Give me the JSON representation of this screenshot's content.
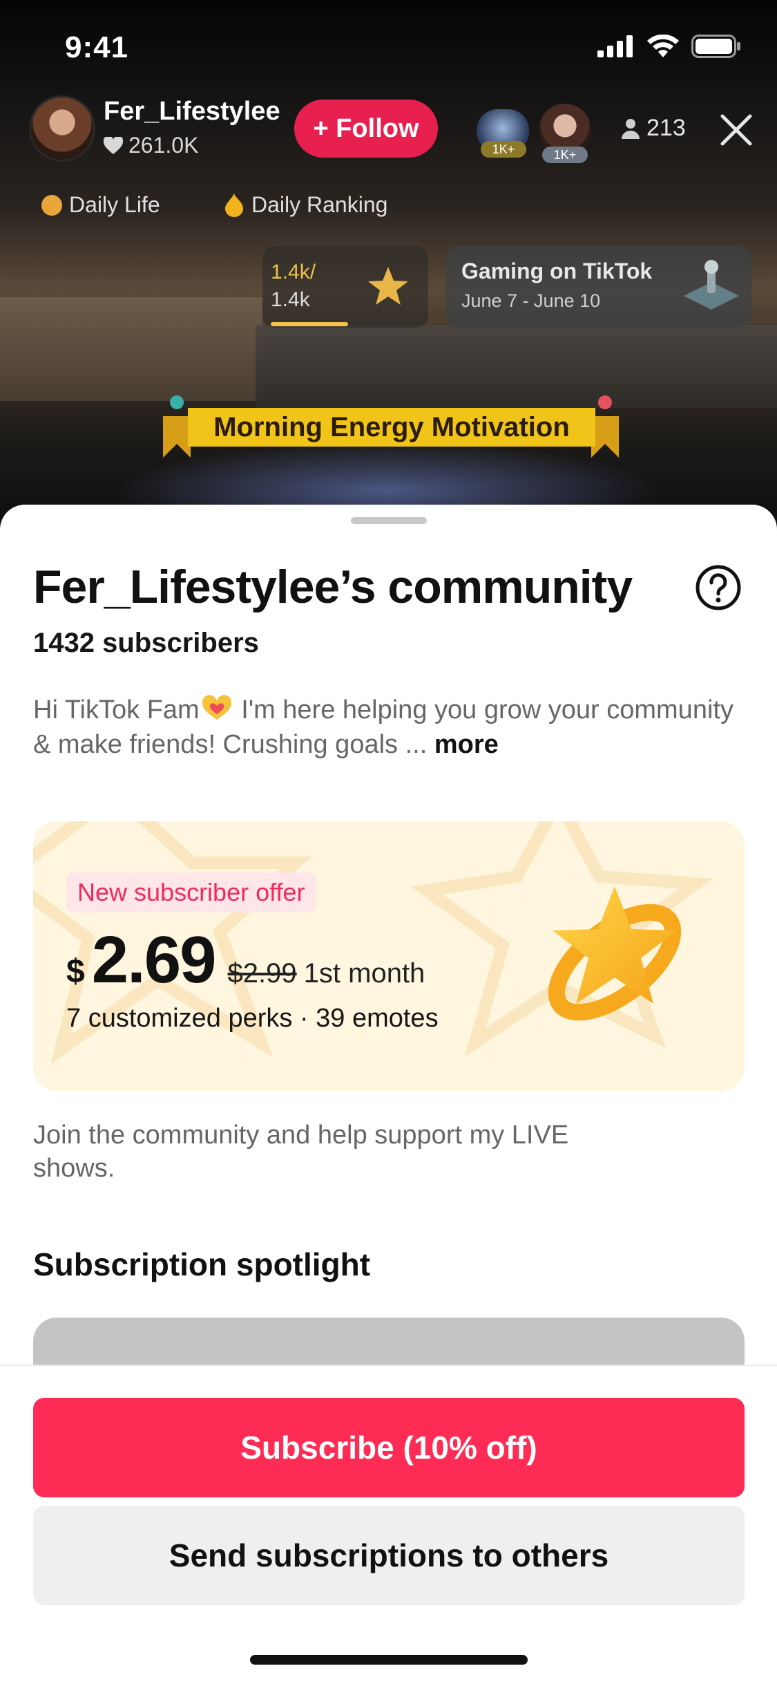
{
  "status": {
    "time": "9:41"
  },
  "host": {
    "name": "Fer_Lifestylee",
    "likes": "261.0K"
  },
  "follow": {
    "label": "+ Follow"
  },
  "viewers": {
    "badge1": "1K+",
    "badge2": "1K+",
    "count": "213"
  },
  "tags": [
    {
      "label": "Daily Life"
    },
    {
      "label": "Daily Ranking"
    }
  ],
  "ranking": {
    "current": "1.4k/",
    "total": "1.4k"
  },
  "event": {
    "title": "Gaming on TikTok",
    "dates": "June 7 - June 10"
  },
  "banner": {
    "text": "Morning Energy Motivation"
  },
  "community": {
    "title": "Fer_Lifestylee’s community",
    "subscribers": "1432 subscribers",
    "bio": "Hi TikTok Fam",
    "bio_rest": " I'm here helping you grow your community & make friends! Crushing goals ... ",
    "more": "more"
  },
  "offer": {
    "badge": "New subscriber offer",
    "currency": "$",
    "price": "2.69",
    "old_price": "$2.99",
    "period": "1st month",
    "perks": "7 customized perks · 39 emotes"
  },
  "join_text": "Join the community and help support my LIVE shows.",
  "spotlight": {
    "title": "Subscription spotlight"
  },
  "actions": {
    "subscribe": "Subscribe (10% off)",
    "gift": "Send subscriptions to others"
  },
  "colors": {
    "primary": "#fe2c55",
    "follow": "#e8204f",
    "offer_bg": "#fff6e0",
    "badge_text": "#ee2b5c",
    "gold": "#f1c24a"
  },
  "icons": [
    "signal-icon",
    "wifi-icon",
    "battery-icon",
    "heart-icon",
    "person-icon",
    "close-icon",
    "help-icon",
    "star-icon",
    "trophy-icon",
    "controller-icon",
    "hands-heart-emoji"
  ]
}
